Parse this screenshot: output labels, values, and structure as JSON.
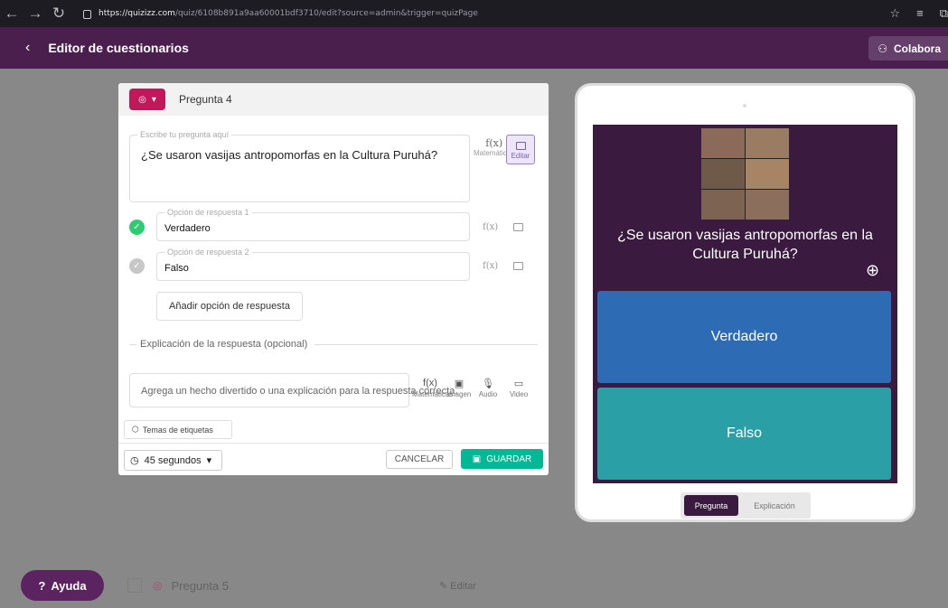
{
  "browser": {
    "url_host": "https://quizizz.com",
    "url_path": "/quiz/6108b891a9aa60001bdf3710/edit?source=admin&trigger=quizPage"
  },
  "header": {
    "title": "Editor de cuestionarios",
    "collaborate_label": "Colabora",
    "bg_color": "#4a1f4e"
  },
  "editor": {
    "question_number": "Pregunta 4",
    "question_legend": "Escribe tu pregunta aquí",
    "question_text": "¿Se usaron vasijas antropomorfas en la Cultura Puruhá?",
    "math_label": "Matemáticas",
    "image_label": "Editar",
    "fx_symbol": "f(x)",
    "options": [
      {
        "legend": "Opción de respuesta 1",
        "text": "Verdadero",
        "correct": true
      },
      {
        "legend": "Opción de respuesta 2",
        "text": "Falso",
        "correct": false
      }
    ],
    "add_option_label": "Añadir opción de respuesta",
    "explanation_heading": "Explicación de la respuesta (opcional)",
    "explanation_placeholder": "Agrega un hecho divertido o una explicación para la respuesta correcta.",
    "tools": {
      "math": "Matemáticas",
      "image": "Imagen",
      "audio": "Audio",
      "video": "Video"
    },
    "tags_label": "Temas de etiquetas",
    "time_label": "45 segundos",
    "cancel_label": "CANCELAR",
    "save_label": "GUARDAR",
    "accent_color": "#c2185b",
    "save_color": "#00b894"
  },
  "next_question": {
    "label": "Pregunta 5",
    "edit_label": "Editar"
  },
  "help_label": "Ayuda",
  "preview": {
    "question_text": "¿Se usaron vasijas antropomorfas en la Cultura Puruhá?",
    "answers": [
      {
        "text": "Verdadero",
        "color": "#2d6bb5"
      },
      {
        "text": "Falso",
        "color": "#2a9fa6"
      }
    ],
    "tab_active": "Pregunta",
    "tab_inactive": "Explicación"
  }
}
